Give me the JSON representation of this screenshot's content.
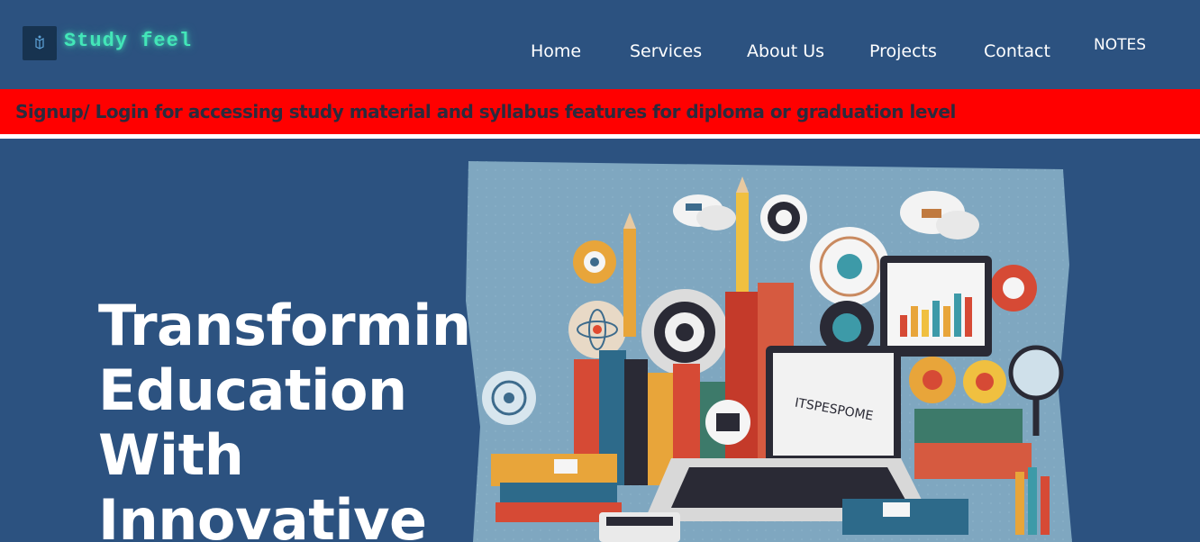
{
  "header": {
    "brand": "Study feel",
    "logo_icon": "book-icon",
    "nav": [
      {
        "label": "Home"
      },
      {
        "label": "Services"
      },
      {
        "label": "About Us"
      },
      {
        "label": "Projects"
      },
      {
        "label": "Contact"
      },
      {
        "label": "NOTES"
      }
    ]
  },
  "announcement": {
    "text": "Signup/ Login for accessing study material and syllabus features for diploma or graduation level"
  },
  "hero": {
    "title_lines": [
      "Transforming",
      "Education",
      "With",
      "Innovative"
    ],
    "illustration": {
      "laptop_screen_text": "ITSPESPOME"
    }
  },
  "colors": {
    "background": "#2c5280",
    "brand_glow": "#43e6b8",
    "announcement_bg": "#ff0000",
    "announcement_text": "#2b2b3d",
    "nav_text": "#ffffff"
  }
}
